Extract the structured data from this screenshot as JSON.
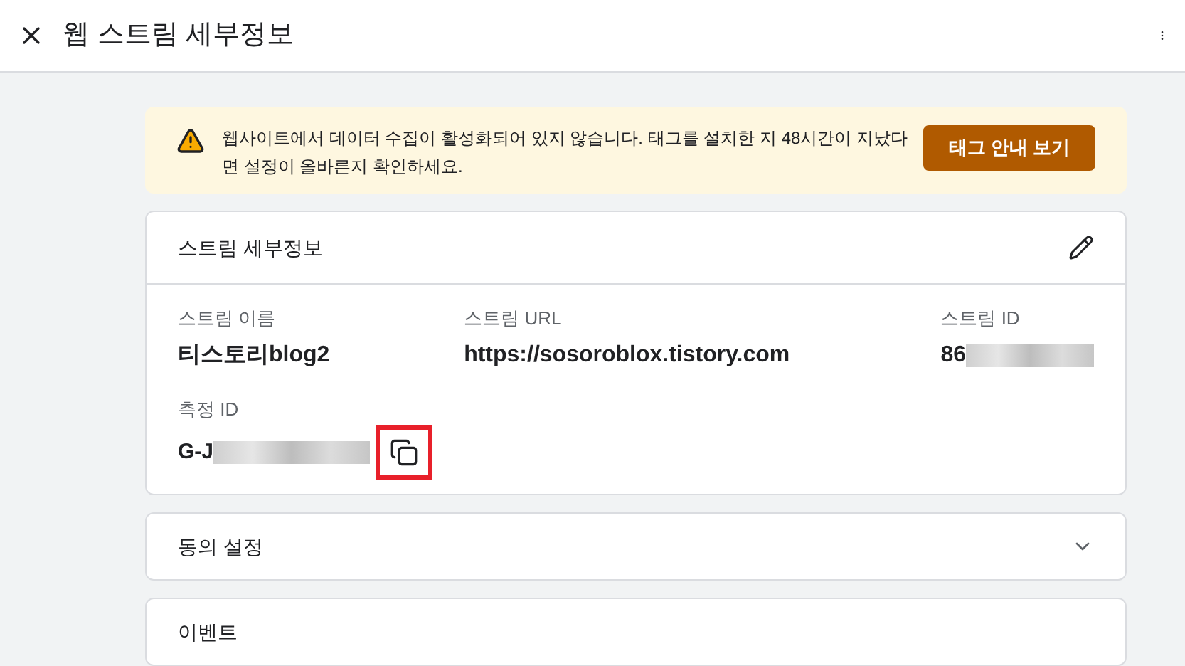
{
  "header": {
    "title": "웹 스트림 세부정보"
  },
  "warning": {
    "message": "웹사이트에서 데이터 수집이 활성화되어 있지 않습니다. 태그를 설치한 지 48시간이 지났다면 설정이 올바른지 확인하세요.",
    "button": "태그 안내 보기"
  },
  "details_card": {
    "title": "스트림 세부정보",
    "fields": [
      {
        "label": "스트림 이름",
        "value": "티스토리blog2",
        "redacted": false
      },
      {
        "label": "스트림 URL",
        "value": "https://sosoroblox.tistory.com",
        "redacted": false
      },
      {
        "label": "스트림 ID",
        "value": "86",
        "redacted": true
      }
    ],
    "measurement": {
      "label": "측정 ID",
      "value": "G-J",
      "redacted": true,
      "highlighted": true
    }
  },
  "sections": [
    {
      "title": "동의 설정",
      "expandable": true
    },
    {
      "title": "이벤트",
      "expandable": false
    }
  ]
}
